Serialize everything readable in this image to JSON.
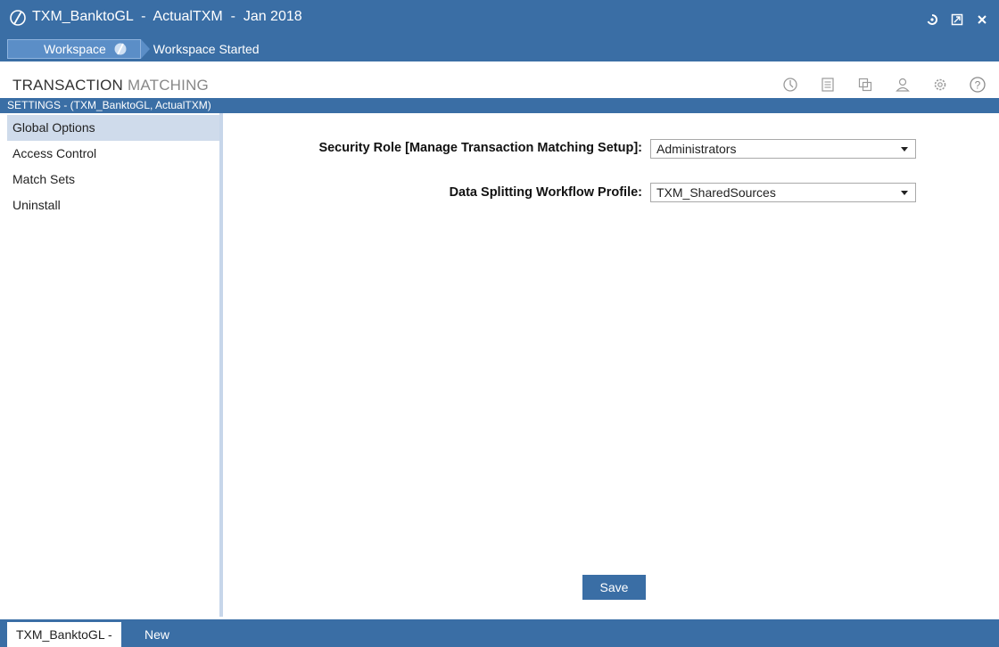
{
  "window": {
    "title": "TXM_BanktoGL  -  ActualTXM  -  Jan 2018",
    "controls": [
      "refresh-icon",
      "restore-icon",
      "close-icon"
    ]
  },
  "breadcrumb": {
    "workspace_label": "Workspace",
    "status": "Workspace Started"
  },
  "module": {
    "title_part1": "TRANSACTION",
    "title_part2": "MATCHING",
    "toolbar": [
      "history-icon",
      "list-icon",
      "copy-icon",
      "user-icon",
      "gear-icon",
      "help-icon"
    ]
  },
  "settings_bar": {
    "text": "SETTINGS - (TXM_BanktoGL, ActualTXM)"
  },
  "sidebar": {
    "items": [
      {
        "label": "Global Options",
        "active": true
      },
      {
        "label": "Access Control",
        "active": false
      },
      {
        "label": "Match Sets",
        "active": false
      },
      {
        "label": "Uninstall",
        "active": false
      }
    ]
  },
  "form": {
    "security_role": {
      "label": "Security Role [Manage Transaction Matching Setup]:",
      "value": "Administrators"
    },
    "workflow_profile": {
      "label": "Data Splitting Workflow Profile:",
      "value": "TXM_SharedSources"
    },
    "save_label": "Save"
  },
  "bottom_tabs": {
    "active_label": "TXM_BanktoGL -",
    "new_label": "New"
  },
  "colors": {
    "accent": "#3a6ea5",
    "sidebar_active": "#cfdbeb"
  }
}
